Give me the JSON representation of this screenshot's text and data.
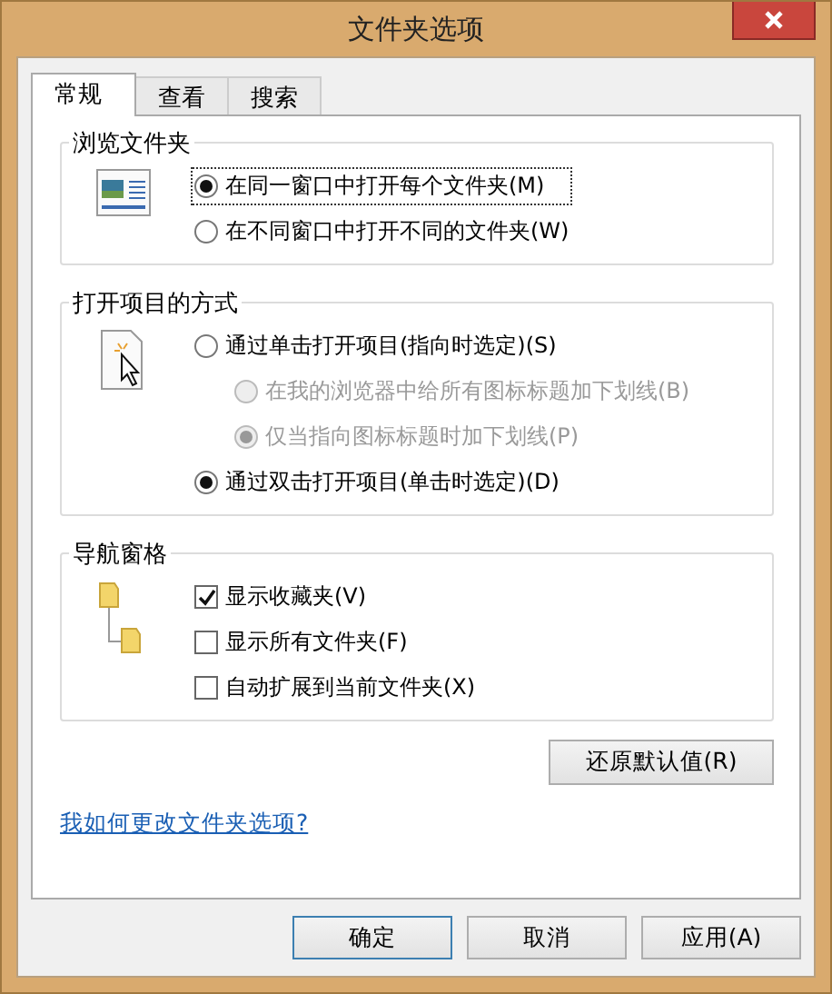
{
  "window": {
    "title": "文件夹选项"
  },
  "tabs": [
    {
      "label": "常规",
      "selected": true
    },
    {
      "label": "查看",
      "selected": false
    },
    {
      "label": "搜索",
      "selected": false
    }
  ],
  "groups": [
    {
      "title": "浏览文件夹",
      "options": [
        {
          "kind": "radio",
          "label": "在同一窗口中打开每个文件夹(M)",
          "selected": true,
          "disabled": false,
          "focused": true,
          "indented": false
        },
        {
          "kind": "radio",
          "label": "在不同窗口中打开不同的文件夹(W)",
          "selected": false,
          "disabled": false,
          "focused": false,
          "indented": false
        }
      ]
    },
    {
      "title": "打开项目的方式",
      "options": [
        {
          "kind": "radio",
          "label": "通过单击打开项目(指向时选定)(S)",
          "selected": false,
          "disabled": false,
          "focused": false,
          "indented": false
        },
        {
          "kind": "radio",
          "label": "在我的浏览器中给所有图标标题加下划线(B)",
          "selected": false,
          "disabled": true,
          "focused": false,
          "indented": true
        },
        {
          "kind": "radio",
          "label": "仅当指向图标标题时加下划线(P)",
          "selected": true,
          "disabled": true,
          "focused": false,
          "indented": true
        },
        {
          "kind": "radio",
          "label": "通过双击打开项目(单击时选定)(D)",
          "selected": true,
          "disabled": false,
          "focused": false,
          "indented": false
        }
      ]
    },
    {
      "title": "导航窗格",
      "options": [
        {
          "kind": "checkbox",
          "label": "显示收藏夹(V)",
          "checked": true,
          "disabled": false,
          "focused": false,
          "indented": false
        },
        {
          "kind": "checkbox",
          "label": "显示所有文件夹(F)",
          "checked": false,
          "disabled": false,
          "focused": false,
          "indented": false
        },
        {
          "kind": "checkbox",
          "label": "自动扩展到当前文件夹(X)",
          "checked": false,
          "disabled": false,
          "focused": false,
          "indented": false
        }
      ]
    }
  ],
  "restore_button": {
    "label": "还原默认值(R)"
  },
  "help_link": "我如何更改文件夹选项?",
  "buttons": [
    {
      "label": "确定",
      "default": true
    },
    {
      "label": "取消",
      "default": false
    },
    {
      "label": "应用(A)",
      "default": false
    }
  ]
}
